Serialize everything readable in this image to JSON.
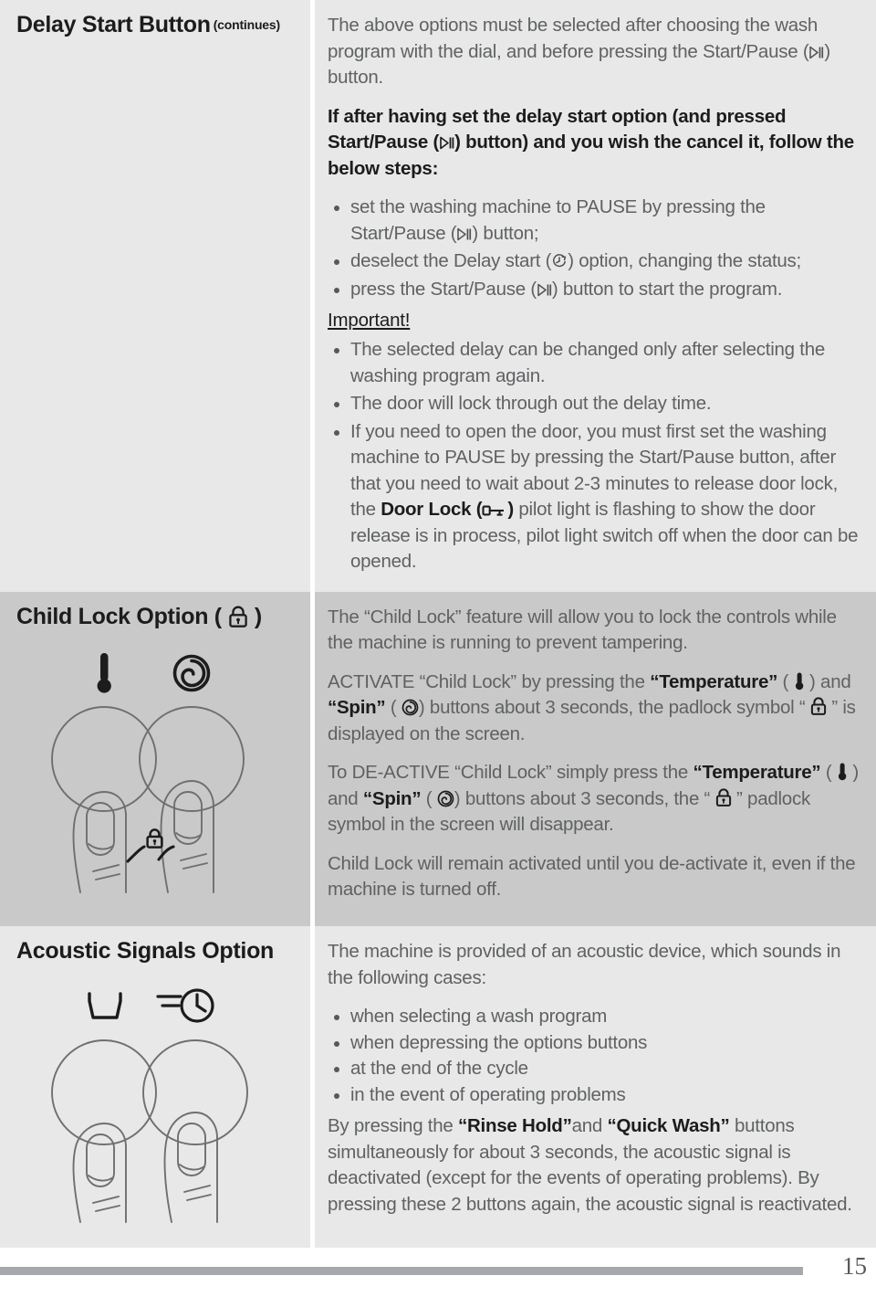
{
  "document": {
    "page_number": "15"
  },
  "sections": [
    {
      "id": "delay-start",
      "title": "Delay Start Button",
      "title_note": "(continues)",
      "intro": {
        "part1": "The above options must be selected after choosing the wash program with the dial, and before pressing the Start/Pause (",
        "part2": ") button."
      },
      "lead": {
        "part1": "If after having set the delay start option (and pressed Start/Pause (",
        "part2": ") button) and you wish the cancel it, follow the below steps:"
      },
      "steps": [
        {
          "part1": "set the washing machine to PAUSE by pressing the Start/Pause (",
          "part2": ") button;",
          "icon": "play-pause-icon"
        },
        {
          "part1": "deselect the Delay start (",
          "part2": ") option, changing the status;",
          "icon": "delay-clock-icon"
        },
        {
          "part1": "press the Start/Pause (",
          "part2": ") button to start the program.",
          "icon": "play-pause-icon"
        }
      ],
      "important_label": "Important!",
      "important_items": [
        {
          "text": "The selected delay can be changed only after selecting the washing program again."
        },
        {
          "text": "The door will lock through out the delay time."
        }
      ],
      "door_note": {
        "part1": "If you need to open the door, you must first set the washing machine to PAUSE by pressing the Start/Pause button, after that you need to wait about 2-3 minutes to release door lock, the ",
        "bold": "Door Lock (",
        "bold_after": ")",
        "part2": " pilot light is flashing to show the door release is in process, pilot light switch off when the door can be opened."
      }
    },
    {
      "id": "child-lock",
      "title": "Child Lock Option (",
      "title_close": ")",
      "p1": "The “Child Lock” feature will allow you to lock the controls while the machine is running to prevent tampering.",
      "p2": {
        "a": "ACTIVATE “Child Lock” by pressing the ",
        "b_temp": "“Temperature”",
        "c": " ( ",
        "d": " ) and ",
        "b_spin": "“Spin”",
        "e": " ( ",
        "f": ") buttons about 3 seconds, the padlock symbol “ ",
        "g": " ” is displayed on the screen."
      },
      "p3": {
        "a": "To DE-ACTIVE “Child Lock” simply press the ",
        "b_temp": "“Temperature”",
        "c": " ( ",
        "d": " ) and ",
        "b_spin": "“Spin”",
        "e": " ( ",
        "f": ") buttons about 3 seconds, the “ ",
        "g": " ” padlock symbol in the screen will disappear."
      },
      "p4": "Child Lock will remain activated until you de-activate it, even if the machine is turned off.",
      "illustration": {
        "left_button_icon": "temperature-icon",
        "right_button_icon": "spin-icon",
        "center_icon": "padlock-icon"
      }
    },
    {
      "id": "acoustic-signals",
      "title": "Acoustic Signals Option",
      "intro": "The machine is provided of an acoustic device, which sounds in the following cases:",
      "cases": [
        "when selecting a wash program",
        "when depressing the options buttons",
        "at the end of the cycle",
        "in the event of operating problems"
      ],
      "outro": {
        "a": "By pressing the ",
        "b_rinse": "“Rinse Hold”",
        "c": "and ",
        "b_quick": "“Quick Wash”",
        "d": " buttons simultaneously for about 3 seconds, the acoustic signal is deactivated (except for the events of operating problems). By pressing these 2 buttons again, the acoustic signal is reactivated."
      },
      "illustration": {
        "left_button_icon": "rinse-hold-icon",
        "right_button_icon": "quick-wash-icon"
      }
    }
  ],
  "colors": {
    "section_light": "#e8e8e8",
    "section_dark": "#c9c9c9",
    "body_text": "#5f6163",
    "heading_text": "#1c1c1c",
    "footer_bar": "#a6a8ab"
  }
}
